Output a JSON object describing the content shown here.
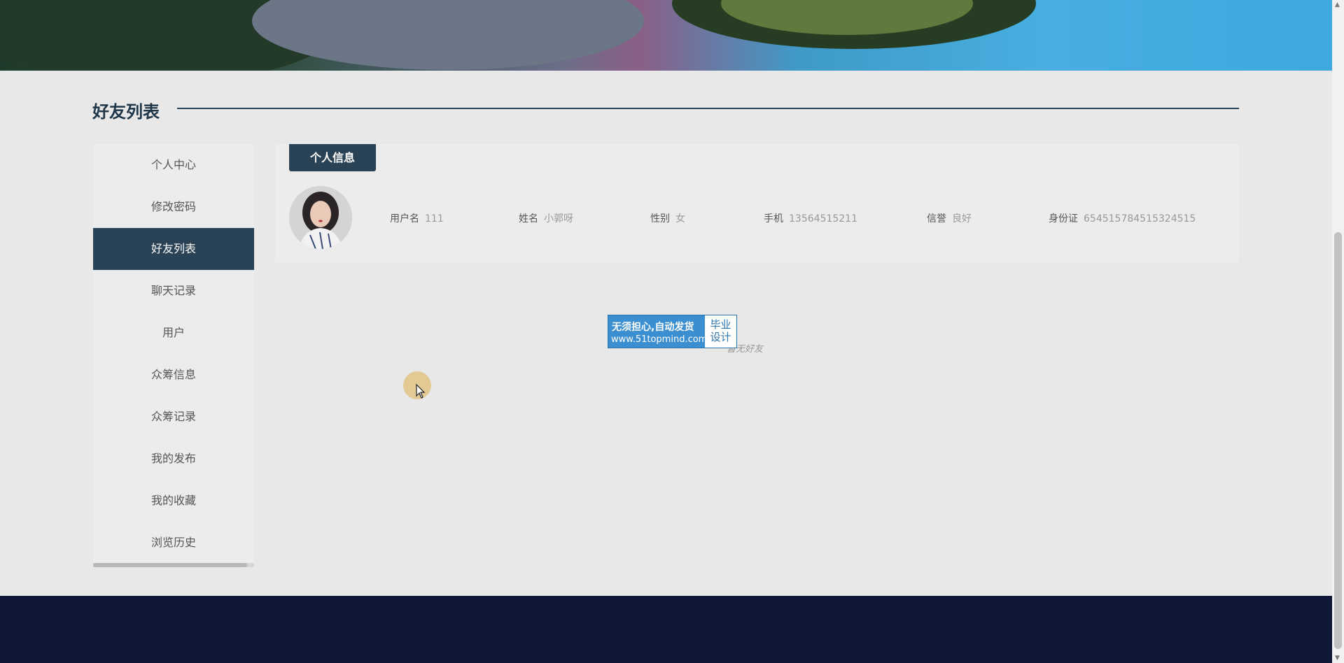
{
  "section": {
    "title": "好友列表"
  },
  "sidebar": {
    "items": [
      {
        "label": "个人中心",
        "active": false
      },
      {
        "label": "修改密码",
        "active": false
      },
      {
        "label": "好友列表",
        "active": true
      },
      {
        "label": "聊天记录",
        "active": false
      },
      {
        "label": "用户",
        "active": false
      },
      {
        "label": "众筹信息",
        "active": false
      },
      {
        "label": "众筹记录",
        "active": false
      },
      {
        "label": "我的发布",
        "active": false
      },
      {
        "label": "我的收藏",
        "active": false
      },
      {
        "label": "浏览历史",
        "active": false
      }
    ]
  },
  "profile": {
    "tab_label": "个人信息",
    "fields": [
      {
        "label": "用户名",
        "value": "111"
      },
      {
        "label": "姓名",
        "value": "小郭呀"
      },
      {
        "label": "性别",
        "value": "女"
      },
      {
        "label": "手机",
        "value": "13564515211"
      },
      {
        "label": "信誉",
        "value": "良好"
      },
      {
        "label": "身份证",
        "value": "654515784515324515"
      }
    ]
  },
  "friends": {
    "empty_text": "暂无好友"
  },
  "ad": {
    "line1": "无须担心,自动发货",
    "line2": "www.51topmind.com",
    "badge_line1": "毕业",
    "badge_line2": "设计"
  },
  "colors": {
    "primary": "#2a4255",
    "footer": "#0f1738",
    "background": "#e8e8e8"
  }
}
